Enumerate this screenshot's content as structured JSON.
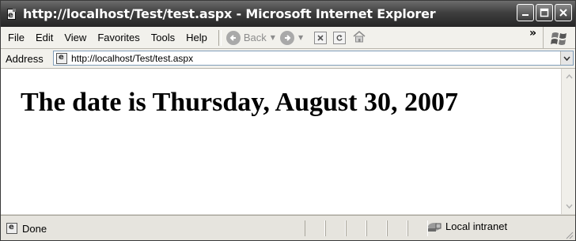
{
  "window": {
    "title": "http://localhost/Test/test.aspx - Microsoft Internet Explorer"
  },
  "menu": {
    "items": [
      "File",
      "Edit",
      "View",
      "Favorites",
      "Tools",
      "Help"
    ]
  },
  "toolbar": {
    "back_label": "Back"
  },
  "address": {
    "label": "Address",
    "url": "http://localhost/Test/test.aspx"
  },
  "content": {
    "heading": "The date is Thursday, August 30, 2007"
  },
  "status": {
    "text": "Done",
    "zone": "Local intranet"
  }
}
